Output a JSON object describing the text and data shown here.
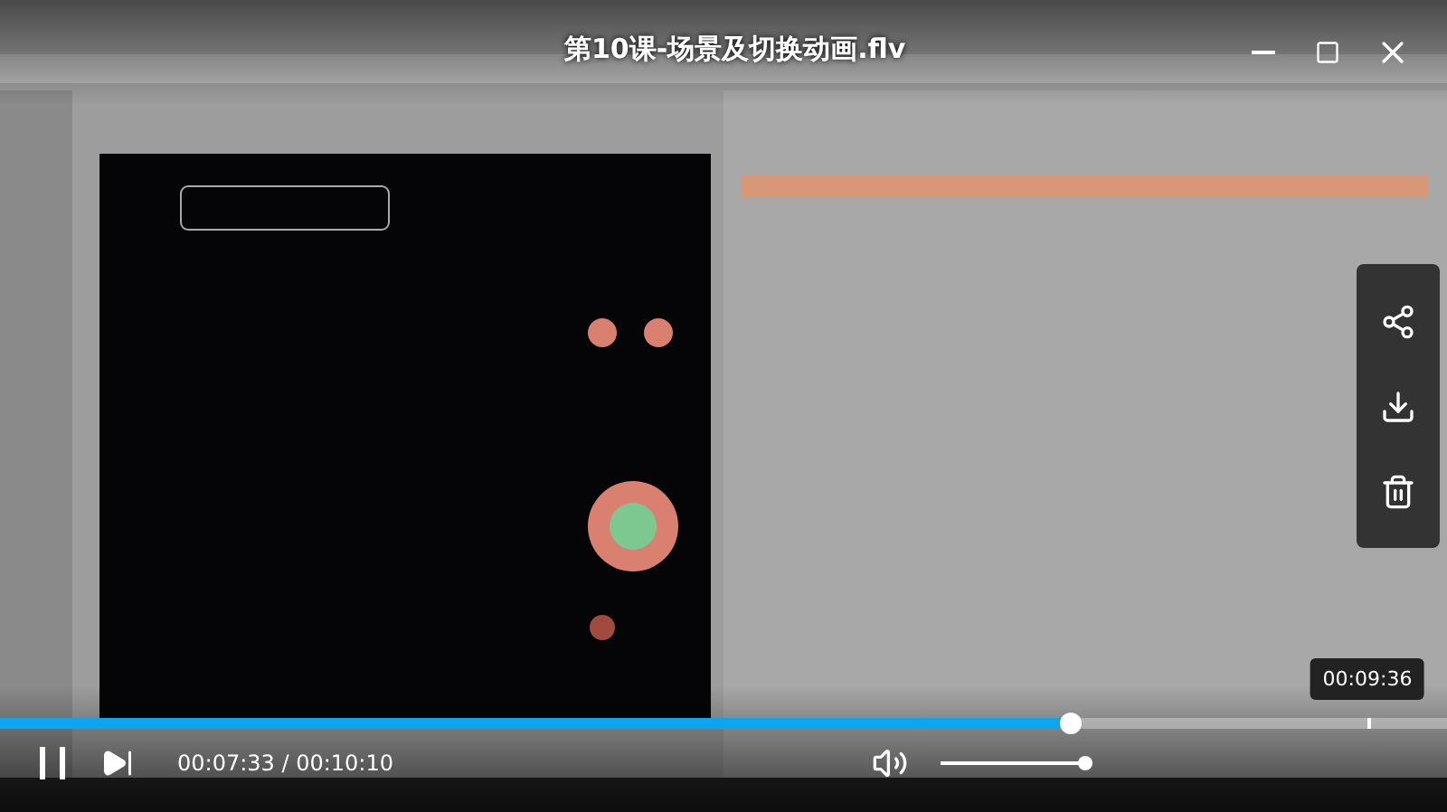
{
  "title": "第10课-场景及切换动画.flv",
  "progress": {
    "level": 0.74,
    "hover_time": "00:09:36"
  },
  "player": {
    "playing": true,
    "time": "00:07:33 / 00:10:10"
  },
  "volume": {
    "level": 1,
    "muted": false
  }
}
